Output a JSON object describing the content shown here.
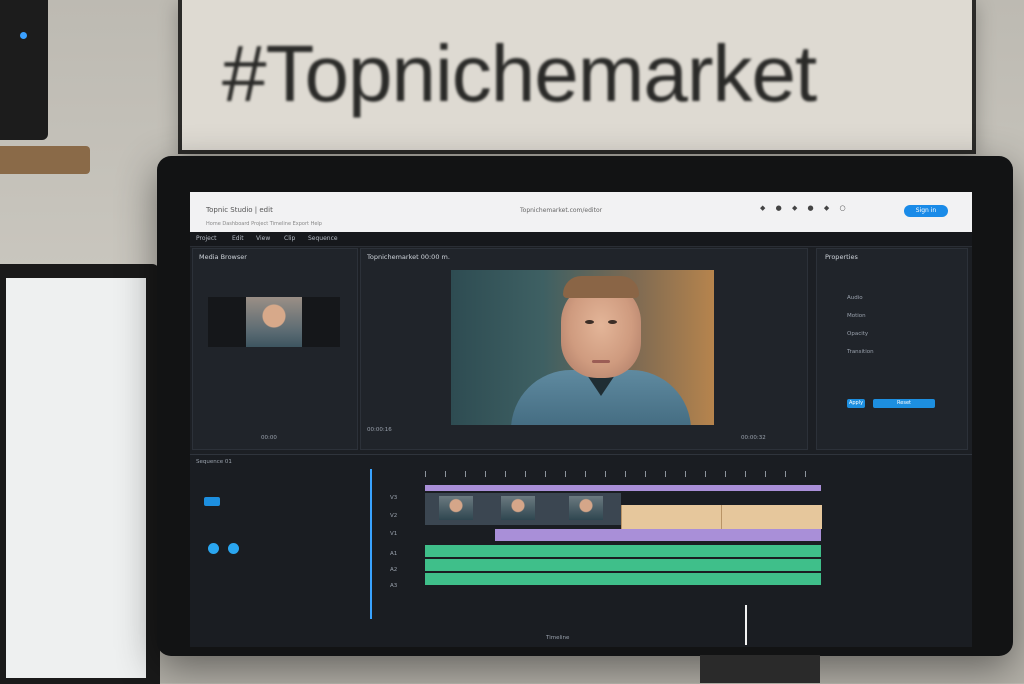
{
  "background": {
    "sign_text": "#Topnichemarket"
  },
  "browser": {
    "tab_title": "Topnic Studio | edit",
    "url_text": "Topnichemarket.com/editor",
    "subtitle": "Home   Dashboard   Project   Timeline   Export   Help",
    "signin_label": "Sign in"
  },
  "app": {
    "menu": [
      "Project",
      "Edit",
      "View",
      "Clip",
      "Sequence"
    ],
    "media_panel_title": "Media Browser",
    "program_title": "Topnichemarket 00:00 m.",
    "effects_title": "Properties",
    "viewer_timecode": "00:00:16",
    "viewer_duration": "00:00:32",
    "media_timecode": "00:00",
    "effects_labels": [
      "Audio",
      "Motion",
      "Opacity",
      "Transition"
    ],
    "effects_buttons": [
      "Apply",
      "Reset"
    ],
    "timeline_label": "Sequence 01",
    "track_labels": [
      "V3",
      "V2",
      "V1",
      "A1",
      "A2",
      "A3"
    ],
    "status": "Timeline"
  },
  "colors": {
    "accent": "#1d8fe0",
    "clip_purple": "#a98fd8",
    "clip_teal": "#3fbf8a",
    "clip_tan": "#e6c79c"
  }
}
